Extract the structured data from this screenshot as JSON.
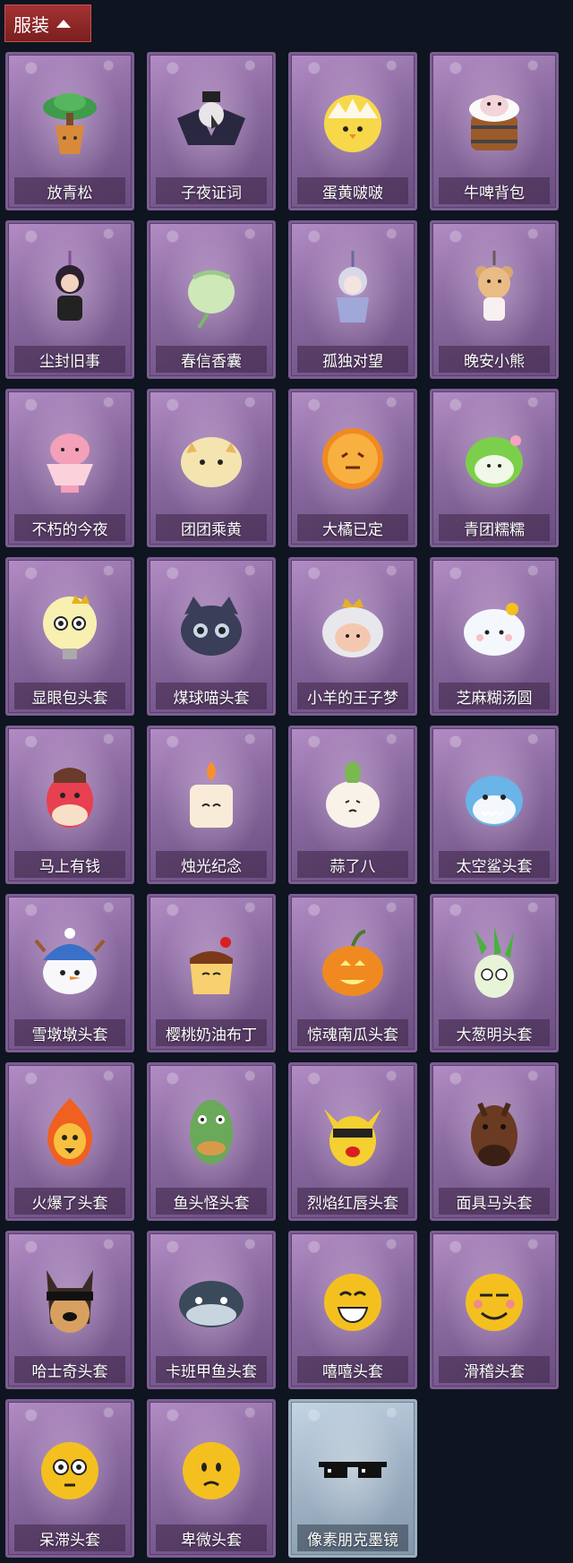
{
  "header": {
    "tab_label": "服装"
  },
  "items": [
    {
      "label": "放青松",
      "icon": "pine-tree-pot-icon"
    },
    {
      "label": "子夜证词",
      "icon": "crow-mask-figure-icon"
    },
    {
      "label": "蛋黄啵啵",
      "icon": "chick-egg-icon"
    },
    {
      "label": "牛啤背包",
      "icon": "cow-beer-mug-icon"
    },
    {
      "label": "尘封旧事",
      "icon": "figure-keychain-icon"
    },
    {
      "label": "春信香囊",
      "icon": "green-sachet-icon"
    },
    {
      "label": "孤独对望",
      "icon": "silver-figure-keychain-icon"
    },
    {
      "label": "晚安小熊",
      "icon": "bear-keychain-icon"
    },
    {
      "label": "不朽的今夜",
      "icon": "pink-fox-bowl-icon"
    },
    {
      "label": "团团乘黄",
      "icon": "cream-cat-head-icon"
    },
    {
      "label": "大橘已定",
      "icon": "orange-slice-icon"
    },
    {
      "label": "青团糯糯",
      "icon": "green-rice-ball-icon"
    },
    {
      "label": "显眼包头套",
      "icon": "lightbulb-head-icon"
    },
    {
      "label": "煤球喵头套",
      "icon": "black-cat-head-icon"
    },
    {
      "label": "小羊的王子梦",
      "icon": "sheep-crown-head-icon"
    },
    {
      "label": "芝麻糊汤圆",
      "icon": "dumpling-flower-icon"
    },
    {
      "label": "马上有钱",
      "icon": "red-horse-head-icon"
    },
    {
      "label": "烛光纪念",
      "icon": "candle-head-icon"
    },
    {
      "label": "蒜了八",
      "icon": "garlic-head-icon"
    },
    {
      "label": "太空鲨头套",
      "icon": "shark-head-icon"
    },
    {
      "label": "雪墩墩头套",
      "icon": "snowman-head-icon"
    },
    {
      "label": "樱桃奶油布丁",
      "icon": "pudding-head-icon"
    },
    {
      "label": "惊魂南瓜头套",
      "icon": "pumpkin-head-icon"
    },
    {
      "label": "大葱明头套",
      "icon": "scallion-head-icon"
    },
    {
      "label": "火爆了头套",
      "icon": "fire-head-icon"
    },
    {
      "label": "鱼头怪头套",
      "icon": "fish-monster-head-icon"
    },
    {
      "label": "烈焰红唇头套",
      "icon": "yellow-mouse-glasses-icon"
    },
    {
      "label": "面具马头套",
      "icon": "horse-mask-icon"
    },
    {
      "label": "哈士奇头套",
      "icon": "husky-glasses-icon"
    },
    {
      "label": "卡班甲鱼头套",
      "icon": "whale-head-icon"
    },
    {
      "label": "嘻嘻头套",
      "icon": "grin-emoji-icon"
    },
    {
      "label": "滑稽头套",
      "icon": "smirk-emoji-icon"
    },
    {
      "label": "呆滞头套",
      "icon": "blank-stare-emoji-icon"
    },
    {
      "label": "卑微头套",
      "icon": "humble-emoji-icon"
    },
    {
      "label": "像素朋克墨镜",
      "icon": "pixel-sunglasses-icon",
      "selected": true
    }
  ],
  "colors": {
    "header_tab": "#a53232",
    "card_bg": "#8a6aa0",
    "selected_bg": "#9fb2c4",
    "page_bg": "#0e1420"
  }
}
